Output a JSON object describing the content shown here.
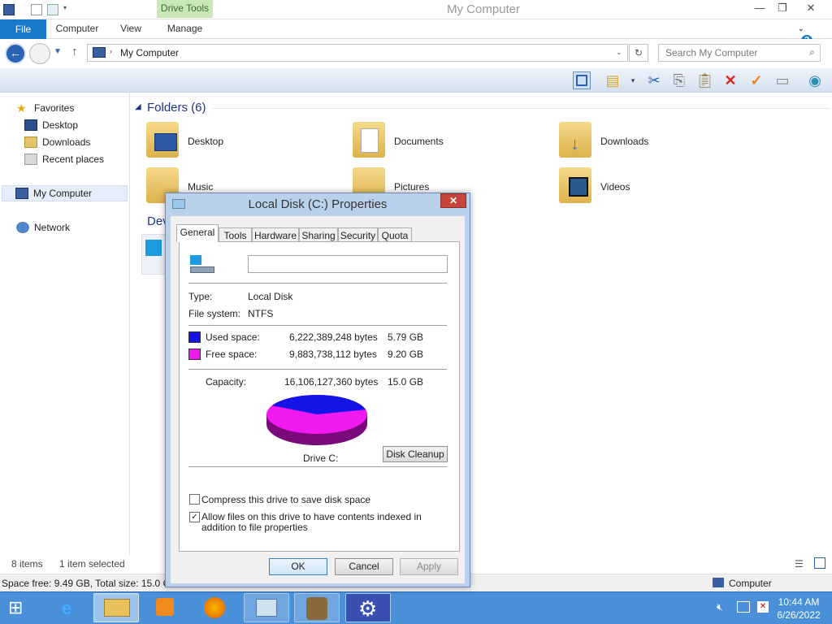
{
  "window": {
    "title": "My Computer",
    "context_tab": "Drive Tools",
    "controls": {
      "minimize": "—",
      "maximize": "❐",
      "close": "✕"
    }
  },
  "ribbon": {
    "tabs": [
      "File",
      "Computer",
      "View",
      "Manage"
    ],
    "help": "?"
  },
  "address": {
    "path": "My Computer",
    "search_placeholder": "Search My Computer"
  },
  "nav": {
    "favorites": "Favorites",
    "desktop": "Desktop",
    "downloads": "Downloads",
    "recent": "Recent places",
    "my_computer": "My Computer",
    "network": "Network"
  },
  "content": {
    "folders_header": "Folders (6)",
    "devices_header": "Dev",
    "folders": [
      "Desktop",
      "Documents",
      "Downloads",
      "Music",
      "Pictures",
      "Videos"
    ]
  },
  "status": {
    "items": "8 items",
    "selected": "1 item selected",
    "space": "Space free: 9.49 GB, Total size: 15.0 GB",
    "location": "Computer"
  },
  "dialog": {
    "title": "Local Disk (C:) Properties",
    "close": "✕",
    "tabs": [
      "General",
      "Tools",
      "Hardware",
      "Sharing",
      "Security",
      "Quota"
    ],
    "name_value": "",
    "type_label": "Type:",
    "type_value": "Local Disk",
    "fs_label": "File system:",
    "fs_value": "NTFS",
    "used_label": "Used space:",
    "used_bytes": "6,222,389,248 bytes",
    "used_gb": "5.79 GB",
    "free_label": "Free space:",
    "free_bytes": "9,883,738,112 bytes",
    "free_gb": "9.20 GB",
    "capacity_label": "Capacity:",
    "capacity_bytes": "16,106,127,360 bytes",
    "capacity_gb": "15.0 GB",
    "drive_label": "Drive C:",
    "cleanup_button": "Disk Cleanup",
    "compress_label": "Compress this drive to save disk space",
    "compress_checked": false,
    "index_label": "Allow files on this drive to have contents indexed in addition to file properties",
    "index_checked": true,
    "ok": "OK",
    "cancel": "Cancel",
    "apply": "Apply",
    "colors": {
      "used": "#1414e6",
      "free": "#f019f0"
    },
    "used_fraction": 0.386
  },
  "taskbar": {
    "time": "10:44 AM",
    "date": "6/26/2022"
  }
}
